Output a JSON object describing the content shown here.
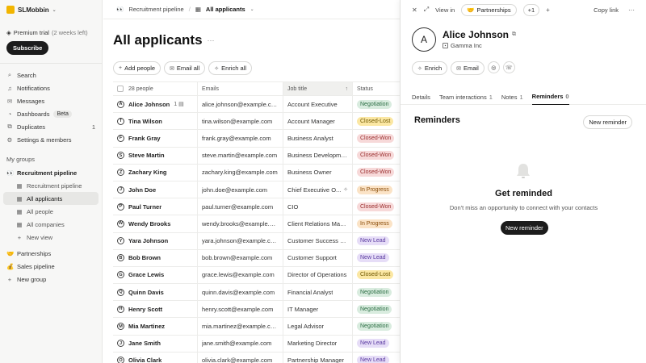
{
  "workspace": {
    "name": "SLMobbin",
    "logo_color": "#f2b500"
  },
  "trial": {
    "title": "Premium trial",
    "left": "(2 weeks left)",
    "subscribe": "Subscribe"
  },
  "nav": [
    {
      "icon": "search-icon",
      "glyph": "⌕",
      "label": "Search"
    },
    {
      "icon": "bell-icon",
      "glyph": "♫",
      "label": "Notifications"
    },
    {
      "icon": "message-icon",
      "glyph": "✉",
      "label": "Messages"
    },
    {
      "icon": "dashboard-icon",
      "glyph": "◔",
      "label": "Dashboards",
      "badge": "Beta"
    },
    {
      "icon": "duplicate-icon",
      "glyph": "⧉",
      "label": "Duplicates",
      "count": "1"
    },
    {
      "icon": "gear-icon",
      "glyph": "⚙",
      "label": "Settings & members"
    }
  ],
  "groups": {
    "heading": "My groups",
    "recruitment": "Recruitment pipeline",
    "views": [
      "Recruitment pipeline",
      "All applicants",
      "All people",
      "All companies",
      "New view"
    ],
    "partnerships": "Partnerships",
    "sales": "Sales pipeline",
    "new_group": "New group"
  },
  "breadcrumb": {
    "parent": "Recruitment pipeline",
    "current": "All applicants"
  },
  "page": {
    "title": "All applicants"
  },
  "actions": {
    "add": "Add people",
    "email": "Email all",
    "enrich": "Enrich all"
  },
  "table": {
    "headers": {
      "count": "28 people",
      "email": "Emails",
      "job": "Job title",
      "status": "Status"
    },
    "rows": [
      {
        "initial": "A",
        "name": "Alice Johnson",
        "comments": "1",
        "email": "alice.johnson@example.com",
        "job": "Account Executive",
        "status": "Negotiation"
      },
      {
        "initial": "T",
        "name": "Tina Wilson",
        "email": "tina.wilson@example.com",
        "job": "Account Manager",
        "status": "Closed-Lost"
      },
      {
        "initial": "F",
        "name": "Frank Gray",
        "email": "frank.gray@example.com",
        "job": "Business Analyst",
        "status": "Closed-Won"
      },
      {
        "initial": "S",
        "name": "Steve Martin",
        "email": "steve.martin@example.com",
        "job": "Business Development",
        "status": "Closed-Won"
      },
      {
        "initial": "Z",
        "name": "Zachary King",
        "email": "zachary.king@example.com",
        "job": "Business Owner",
        "status": "Closed-Won"
      },
      {
        "initial": "J",
        "name": "John Doe",
        "email": "john.doe@example.com",
        "job": "Chief Executive O...",
        "status": "In Progress",
        "sparkle": true
      },
      {
        "initial": "P",
        "name": "Paul Turner",
        "email": "paul.turner@example.com",
        "job": "CIO",
        "status": "Closed-Won"
      },
      {
        "initial": "W",
        "name": "Wendy Brooks",
        "email": "wendy.brooks@example.com",
        "job": "Client Relations Mana...",
        "status": "In Progress"
      },
      {
        "initial": "Y",
        "name": "Yara Johnson",
        "email": "yara.johnson@example.com",
        "job": "Customer Success M...",
        "status": "New Lead"
      },
      {
        "initial": "B",
        "name": "Bob Brown",
        "email": "bob.brown@example.com",
        "job": "Customer Support",
        "status": "New Lead"
      },
      {
        "initial": "G",
        "name": "Grace Lewis",
        "email": "grace.lewis@example.com",
        "job": "Director of Operations",
        "status": "Closed-Lost"
      },
      {
        "initial": "Q",
        "name": "Quinn Davis",
        "email": "quinn.davis@example.com",
        "job": "Financial Analyst",
        "status": "Negotiation"
      },
      {
        "initial": "H",
        "name": "Henry Scott",
        "email": "henry.scott@example.com",
        "job": "IT Manager",
        "status": "Negotiation"
      },
      {
        "initial": "M",
        "name": "Mia Martinez",
        "email": "mia.martinez@example.com",
        "job": "Legal Advisor",
        "status": "Negotiation"
      },
      {
        "initial": "J",
        "name": "Jane Smith",
        "email": "jane.smith@example.com",
        "job": "Marketing Director",
        "status": "New Lead"
      },
      {
        "initial": "O",
        "name": "Olivia Clark",
        "email": "olivia.clark@example.com",
        "job": "Partnership Manager",
        "status": "New Lead"
      }
    ]
  },
  "status_colors": {
    "Negotiation": {
      "bg": "#d9ecdf",
      "fg": "#2c6e44"
    },
    "Closed-Lost": {
      "bg": "#fbe7a3",
      "fg": "#6e5600"
    },
    "Closed-Won": {
      "bg": "#f7d9d9",
      "fg": "#9a2f2f"
    },
    "In Progress": {
      "bg": "#fbe3c6",
      "fg": "#8a4d0a"
    },
    "New Lead": {
      "bg": "#e6ddf7",
      "fg": "#5a3aa0"
    }
  },
  "panel": {
    "view_in": "View in",
    "view_chip": "Partnerships",
    "plus_count": "+1",
    "copy_link": "Copy link",
    "avatar": "A",
    "name": "Alice Johnson",
    "company": "Gamma Inc",
    "enrich": "Enrich",
    "email": "Email",
    "tabs": [
      {
        "label": "Details",
        "count": ""
      },
      {
        "label": "Team interactions",
        "count": "1"
      },
      {
        "label": "Notes",
        "count": "1"
      },
      {
        "label": "Reminders",
        "count": "0",
        "active": true
      }
    ],
    "reminders_title": "Reminders",
    "new_reminder": "New reminder",
    "empty_title": "Get reminded",
    "empty_sub": "Don't miss an opportunity to connect with your contacts",
    "empty_button": "New reminder"
  }
}
